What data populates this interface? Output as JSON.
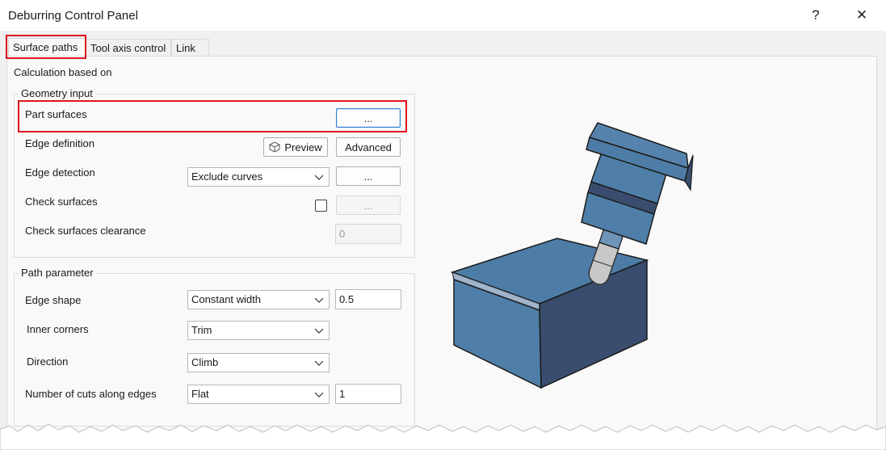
{
  "window": {
    "title": "Deburring Control Panel",
    "help_label": "?",
    "close_label": "✕"
  },
  "tabs": [
    {
      "label": "Surface paths",
      "active": true
    },
    {
      "label": "Tool axis control",
      "active": false
    },
    {
      "label": "Link",
      "active": false
    }
  ],
  "calc_label": "Calculation based on",
  "geometry": {
    "title": "Geometry input",
    "part_surfaces_label": "Part surfaces",
    "part_surfaces_button": "...",
    "edge_definition_label": "Edge definition",
    "preview_button": "Preview",
    "advanced_button": "Advanced",
    "edge_detection_label": "Edge detection",
    "edge_detection_value": "Exclude curves",
    "edge_detection_button": "...",
    "check_surfaces_label": "Check surfaces",
    "check_surfaces_checked": false,
    "check_surfaces_button": "...",
    "check_clearance_label": "Check surfaces clearance",
    "check_clearance_value": "0"
  },
  "path": {
    "title": "Path parameter",
    "edge_shape_label": "Edge shape",
    "edge_shape_value": "Constant width",
    "edge_shape_width": "0.5",
    "inner_corners_label": "Inner corners",
    "inner_corners_value": "Trim",
    "direction_label": "Direction",
    "direction_value": "Climb",
    "num_cuts_label": "Number of cuts along edges",
    "num_cuts_mode": "Flat",
    "num_cuts_value": "1"
  },
  "colors": {
    "highlight": "#e0141e",
    "part_top": "#4d7ca6",
    "part_front": "#4f7fa8",
    "part_side": "#3a4d6e",
    "focus_border": "#2e7bcf"
  }
}
